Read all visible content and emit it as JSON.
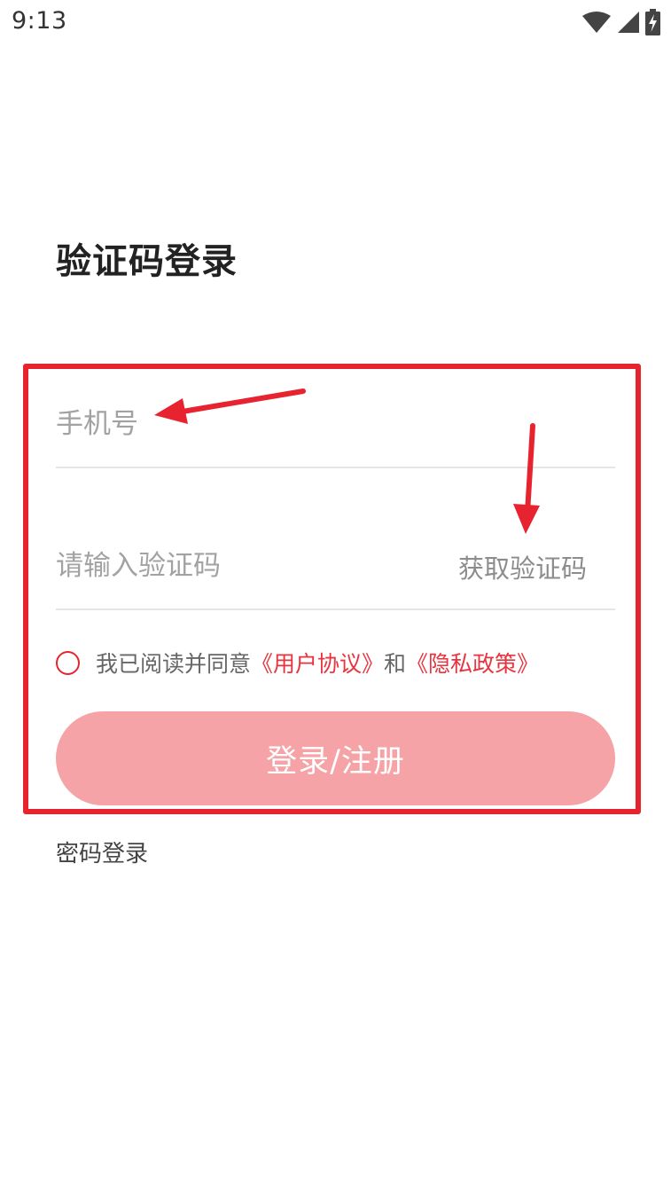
{
  "status_bar": {
    "time": "9:13",
    "icons": [
      "wifi-icon",
      "cell-signal-icon",
      "battery-charging-icon"
    ]
  },
  "page": {
    "title": "验证码登录"
  },
  "form": {
    "phone": {
      "placeholder": "手机号",
      "value": ""
    },
    "code": {
      "placeholder": "请输入验证码",
      "value": "",
      "get_code_label": "获取验证码"
    },
    "agreement": {
      "prefix": "我已阅读并同意",
      "user_agreement": "《用户协议》",
      "conjunction": "和",
      "privacy_policy": "《隐私政策》",
      "checked": false
    },
    "submit_label": "登录/注册"
  },
  "footer": {
    "password_login_label": "密码登录"
  },
  "colors": {
    "accent": "#e82330",
    "button_disabled": "#f5a3a6",
    "annotation": "#e82330"
  }
}
